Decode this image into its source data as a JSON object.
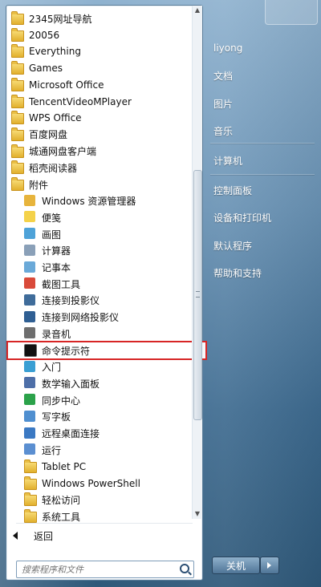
{
  "programs": [
    {
      "label": "2345网址导航",
      "icon": "folder-icon",
      "level": 0
    },
    {
      "label": "20056",
      "icon": "folder-icon",
      "level": 0
    },
    {
      "label": "Everything",
      "icon": "folder-icon",
      "level": 0
    },
    {
      "label": "Games",
      "icon": "folder-icon",
      "level": 0
    },
    {
      "label": "Microsoft Office",
      "icon": "folder-icon",
      "level": 0
    },
    {
      "label": "TencentVideoMPlayer",
      "icon": "folder-icon",
      "level": 0
    },
    {
      "label": "WPS Office",
      "icon": "folder-icon",
      "level": 0
    },
    {
      "label": "百度网盘",
      "icon": "folder-icon",
      "level": 0
    },
    {
      "label": "城通网盘客户端",
      "icon": "folder-icon",
      "level": 0
    },
    {
      "label": "稻壳阅读器",
      "icon": "folder-icon",
      "level": 0
    },
    {
      "label": "附件",
      "icon": "folder-icon",
      "level": 0
    },
    {
      "label": "Windows 资源管理器",
      "icon": "explorer-icon",
      "level": 1
    },
    {
      "label": "便笺",
      "icon": "sticky-notes-icon",
      "level": 1
    },
    {
      "label": "画图",
      "icon": "paint-icon",
      "level": 1
    },
    {
      "label": "计算器",
      "icon": "calculator-icon",
      "level": 1
    },
    {
      "label": "记事本",
      "icon": "notepad-icon",
      "level": 1
    },
    {
      "label": "截图工具",
      "icon": "snipping-tool-icon",
      "level": 1
    },
    {
      "label": "连接到投影仪",
      "icon": "projector-icon",
      "level": 1
    },
    {
      "label": "连接到网络投影仪",
      "icon": "network-projector-icon",
      "level": 1
    },
    {
      "label": "录音机",
      "icon": "microphone-icon",
      "level": 1
    },
    {
      "label": "命令提示符",
      "icon": "command-prompt-icon",
      "level": 1,
      "selected": true
    },
    {
      "label": "入门",
      "icon": "getting-started-icon",
      "level": 1
    },
    {
      "label": "数学输入面板",
      "icon": "math-input-icon",
      "level": 1
    },
    {
      "label": "同步中心",
      "icon": "sync-center-icon",
      "level": 1
    },
    {
      "label": "写字板",
      "icon": "wordpad-icon",
      "level": 1
    },
    {
      "label": "远程桌面连接",
      "icon": "remote-desktop-icon",
      "level": 1
    },
    {
      "label": "运行",
      "icon": "run-icon",
      "level": 1
    },
    {
      "label": "Tablet PC",
      "icon": "folder-icon",
      "level": 1
    },
    {
      "label": "Windows PowerShell",
      "icon": "folder-icon",
      "level": 1
    },
    {
      "label": "轻松访问",
      "icon": "folder-icon",
      "level": 1
    },
    {
      "label": "系统工具",
      "icon": "folder-icon",
      "level": 1
    }
  ],
  "back_label": "返回",
  "search_placeholder": "搜索程序和文件",
  "right_items": [
    {
      "label": "liyong",
      "name": "user-folder"
    },
    {
      "label": "文档",
      "name": "documents"
    },
    {
      "label": "图片",
      "name": "pictures"
    },
    {
      "label": "音乐",
      "name": "music"
    },
    {
      "label": "计算机",
      "name": "computer"
    },
    {
      "label": "控制面板",
      "name": "control-panel"
    },
    {
      "label": "设备和打印机",
      "name": "devices-printers"
    },
    {
      "label": "默认程序",
      "name": "default-programs"
    },
    {
      "label": "帮助和支持",
      "name": "help-support"
    }
  ],
  "shutdown_label": "关机",
  "colors": {
    "selection_outline": "#d72525",
    "folder": "#e1b02d"
  }
}
